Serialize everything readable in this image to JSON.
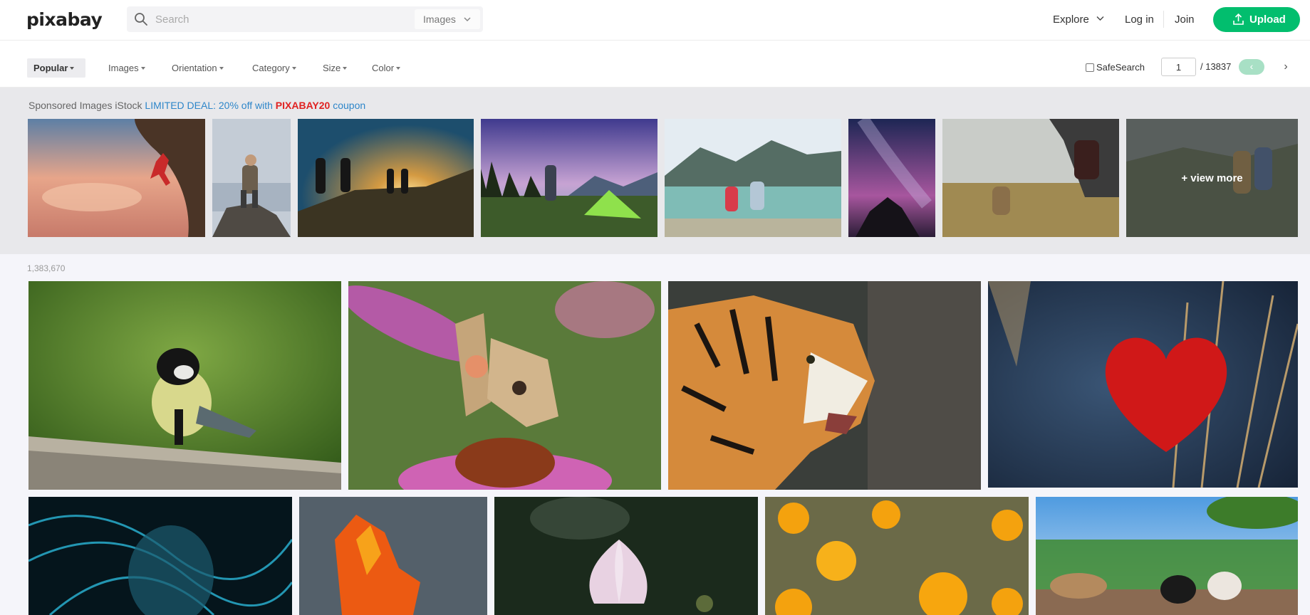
{
  "header": {
    "logo": "pixabay",
    "search_placeholder": "Search",
    "search_type": "Images",
    "nav": {
      "explore": "Explore",
      "login": "Log in",
      "join": "Join",
      "upload": "Upload"
    }
  },
  "filters": {
    "popular": "Popular",
    "images": "Images",
    "orientation": "Orientation",
    "category": "Category",
    "size": "Size",
    "color": "Color",
    "safesearch": "SafeSearch",
    "page_current": "1",
    "page_total": "/ 13837",
    "prev": "‹",
    "next": "›"
  },
  "sponsored": {
    "prefix": "Sponsored Images iStock",
    "deal": "LIMITED DEAL: 20% off with",
    "code": "PIXABAY20",
    "suffix": "coupon",
    "view_more": "+ view more"
  },
  "results_count": "1,383,670",
  "colors": {
    "accent": "#02be6e",
    "deal_blue": "#2e86c9",
    "code_red": "#e02222"
  }
}
